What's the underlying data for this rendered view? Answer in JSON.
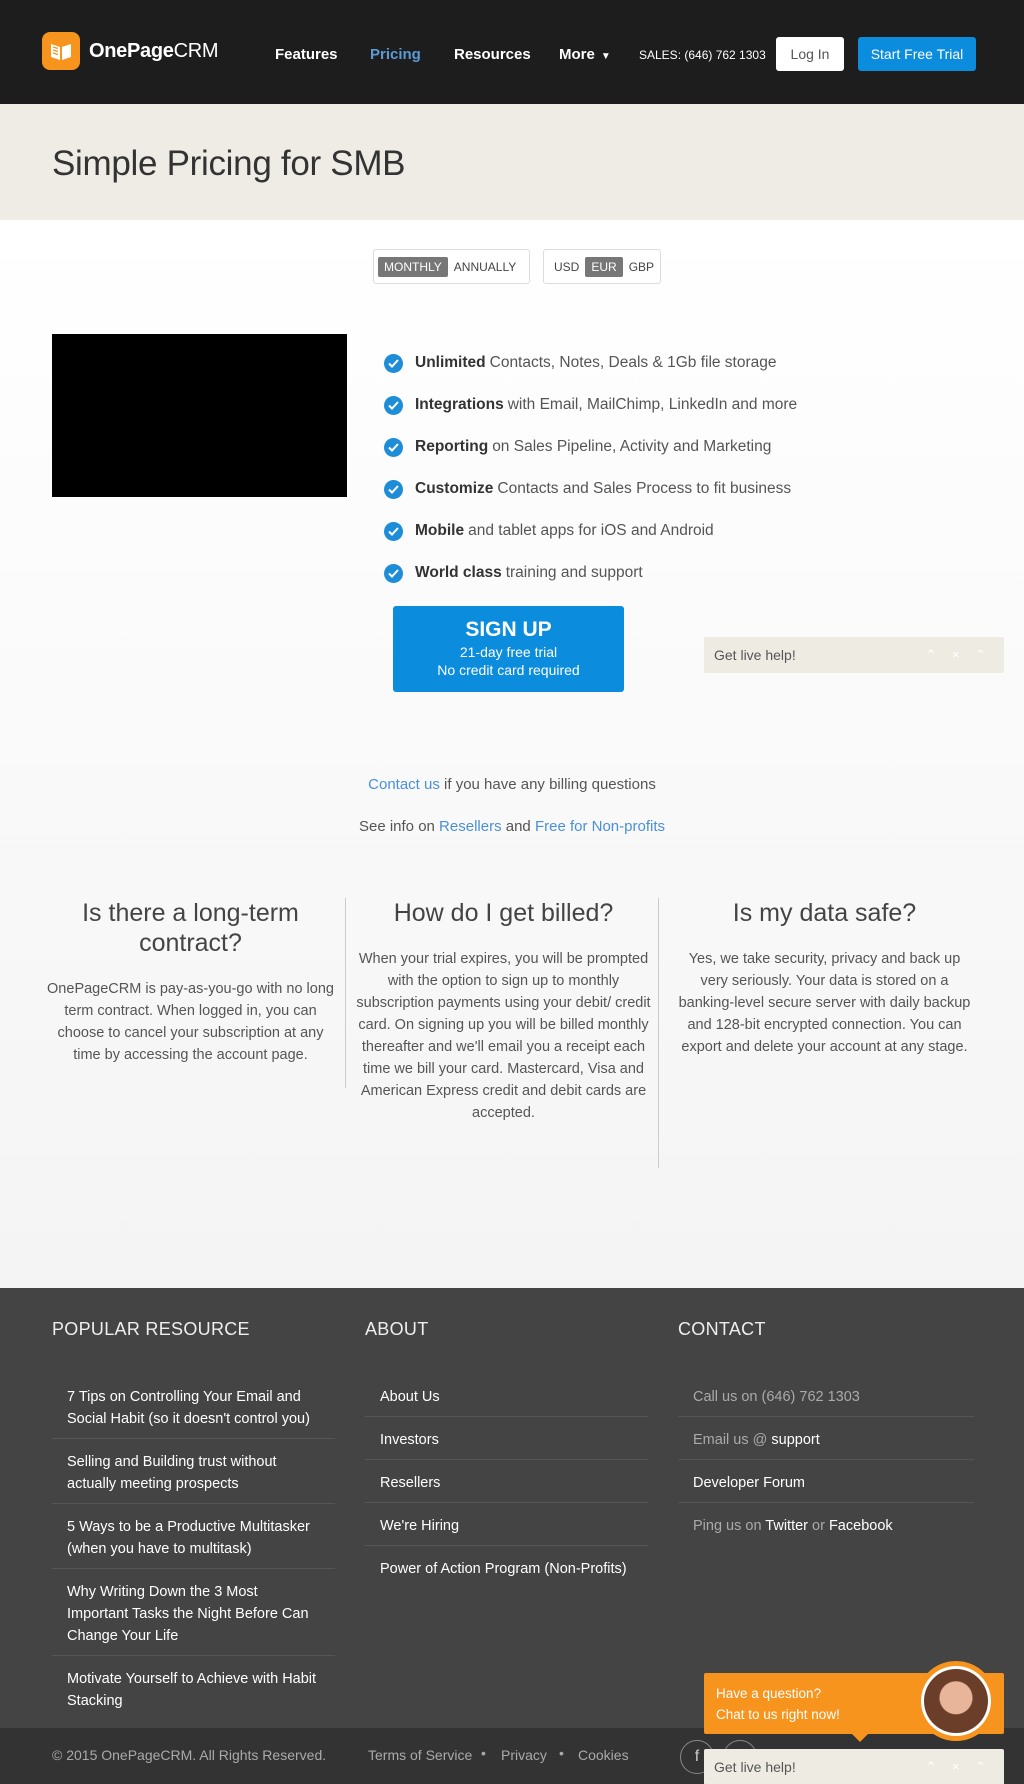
{
  "header": {
    "logo_bold": "OnePage",
    "logo_light": "CRM",
    "nav": [
      "Features",
      "Pricing",
      "Resources",
      "More"
    ],
    "sales": "SALES: (646) 762 1303",
    "login": "Log In",
    "trial": "Start Free Trial"
  },
  "hero": {
    "title": "Simple Pricing for SMB"
  },
  "billing_toggle": {
    "monthly": "MONTHLY",
    "annually": "ANNUALLY"
  },
  "currency_toggle": {
    "usd": "USD",
    "eur": "EUR",
    "gbp": "GBP"
  },
  "features": [
    {
      "bold": "Unlimited",
      "rest": "Contacts, Notes, Deals & 1Gb file storage"
    },
    {
      "bold": "Integrations",
      "rest": "with Email, MailChimp, LinkedIn and more"
    },
    {
      "bold": "Reporting",
      "rest": "on Sales Pipeline, Activity and Marketing"
    },
    {
      "bold": "Customize",
      "rest": "Contacts and Sales Process to fit business"
    },
    {
      "bold": "Mobile",
      "rest": "and tablet apps for iOS and Android"
    },
    {
      "bold": "World class",
      "rest": "training and support"
    }
  ],
  "signup": {
    "title": "SIGN UP",
    "line1": "21-day free trial",
    "line2": "No credit card required"
  },
  "livehelp": {
    "label": "Get live help!"
  },
  "billing_info": {
    "contact_link": "Contact us",
    "contact_rest": " if you have any billing questions",
    "see_info": "See info on ",
    "resellers": "Resellers",
    "and": " and ",
    "nonprofits": "Free for Non-profits"
  },
  "faq": [
    {
      "q": "Is there a long-term contract?",
      "a": "OnePageCRM is pay-as-you-go with no long term contract. When logged in, you can choose to cancel your subscription at any time by accessing the account page."
    },
    {
      "q": "How do I get billed?",
      "a": "When your trial expires, you will be prompted with the option to sign up to monthly subscription payments using your debit/ credit card. On signing up you will be billed monthly thereafter and we'll email you a receipt each time we bill your card. Mastercard, Visa and American Express credit and debit cards are accepted."
    },
    {
      "q": "Is my data safe?",
      "a": "Yes, we take security, privacy and back up very seriously. Your data is stored on a banking-level secure server with daily backup and 128-bit encrypted connection. You can export and delete your account at any stage."
    }
  ],
  "footer": {
    "popular_heading": "POPULAR RESOURCE",
    "about_heading": "ABOUT",
    "contact_heading": "CONTACT",
    "popular": [
      "7 Tips on Controlling Your Email and Social Habit (so it doesn't control you)",
      "Selling and Building trust without actually meeting prospects",
      "5 Ways to be a Productive Multitasker (when you have to multitask)",
      "Why Writing Down the 3 Most Important Tasks the Night Before Can Change Your Life",
      "Motivate Yourself to Achieve with Habit Stacking"
    ],
    "about": [
      "About Us",
      "Investors",
      "Resellers",
      "We're Hiring",
      "Power of Action Program (Non-Profits)"
    ],
    "contact": {
      "call": "Call us on (646) 762 1303",
      "email_prefix": "Email us @ ",
      "email_link": "support",
      "forum": "Developer Forum",
      "ping_prefix": "Ping us on ",
      "twitter": "Twitter",
      "or": " or ",
      "facebook": "Facebook"
    },
    "copyright": "© 2015 OnePageCRM. All Rights Reserved.",
    "links": [
      "Terms of Service",
      "Privacy",
      "Cookies"
    ]
  },
  "chat": {
    "line1": "Have a question?",
    "line2": "Chat to us right now!"
  },
  "colors": {
    "brand_orange": "#f7941d",
    "brand_blue": "#0b8cdc",
    "link_blue": "#4a90d9"
  }
}
